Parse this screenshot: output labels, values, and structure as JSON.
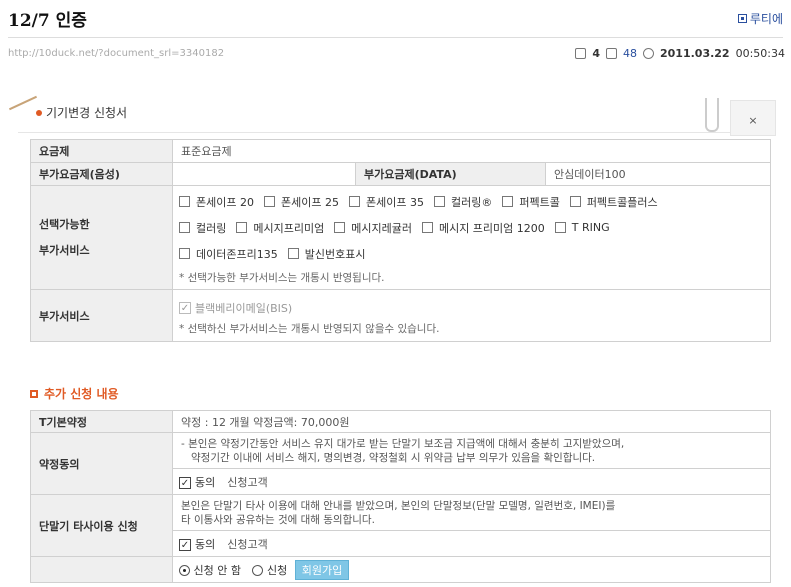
{
  "page": {
    "title": "12/7 인증",
    "ruti_link": "루티에",
    "url": "http://10duck.net/?document_srl=3340182",
    "meta": {
      "comments": "4",
      "views": "48",
      "date": "2011.03.22",
      "time": "00:50:34"
    }
  },
  "form": {
    "title": "기기변경 신청서",
    "close": "×",
    "rows": {
      "plan_label": "요금제",
      "plan_value": "표준요금제",
      "addon_voice_label": "부가요금제(음성)",
      "addon_voice_value": "",
      "addon_data_label": "부가요금제(DATA)",
      "addon_data_value": "안심데이터100",
      "selectable_label_1": "선택가능한",
      "selectable_label_2": "부가서비스",
      "selectable_options": [
        "폰세이프 20",
        "폰세이프 25",
        "폰세이프 35",
        "컬러링®",
        "퍼펙트콜",
        "퍼펙트콜플러스",
        "컬러링",
        "메시지프리미엄",
        "메시지레귤러",
        "메시지 프리미엄 1200",
        "T RING",
        "데이터존프리135",
        "발신번호표시"
      ],
      "selectable_note": "* 선택가능한 부가서비스는 개통시 반영됩니다.",
      "addon_label": "부가서비스",
      "addon_checked": "블랙베리이메일(BIS)",
      "addon_note": "* 선택하신 부가서비스는 개통시 반영되지 않을수 있습니다."
    }
  },
  "extra": {
    "title": "추가 신청 내용",
    "contract_label": "T기본약정",
    "contract_value": "약정 : 12 개월 약정금액: 70,000원",
    "agree_label": "약정동의",
    "agree_text_1": "- 본인은 약정기간동안 서비스 유지 대가로 받는 단말기 보조금 지급액에 대해서 충분히 고지받았으며,",
    "agree_text_2": "약정기간 이내에 서비스 해지, 명의변경, 약정철회 시 위약금 납부 의무가 있음을 확인합니다.",
    "agree_check": "동의",
    "agree_customer": "신청고객",
    "share_label": "단말기 타사이용 신청",
    "share_text_1": "본인은 단말기 타사 이용에 대해 안내를 받았으며, 본인의 단말정보(단말 모델명, 일련번호, IMEI)를",
    "share_text_2": "타 이통사와 공유하는 것에 대해 동의합니다.",
    "share_check": "동의",
    "share_customer": "신청고객",
    "radio_no": "신청 안 함",
    "radio_yes": "신청",
    "join_button": "회원가입"
  }
}
